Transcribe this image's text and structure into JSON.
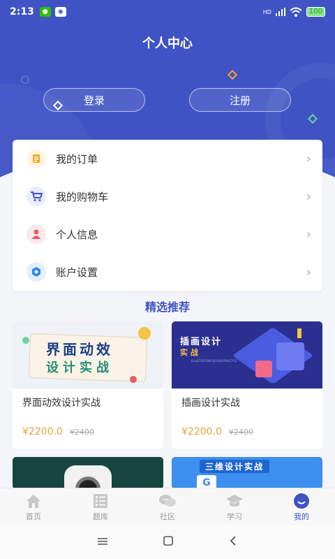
{
  "status": {
    "time": "2:13",
    "battery": "100",
    "signal_label": "HD"
  },
  "page": {
    "title": "个人中心"
  },
  "auth": {
    "login": "登录",
    "register": "注册"
  },
  "menu": [
    {
      "label": "我的订单",
      "icon": "order-icon",
      "color": "#f5a623"
    },
    {
      "label": "我的购物车",
      "icon": "cart-icon",
      "color": "#3f53c4"
    },
    {
      "label": "个人信息",
      "icon": "person-icon",
      "color": "#e85a6a"
    },
    {
      "label": "账户设置",
      "icon": "settings-hexagon-icon",
      "color": "#2f86f6"
    }
  ],
  "recommend": {
    "title": "精选推荐"
  },
  "courses": [
    {
      "name": "界面动效设计实战",
      "price": "¥2200.0",
      "old_price": "¥2400",
      "thumb_text_1": "界面动效",
      "thumb_text_2": "设计实战"
    },
    {
      "name": "插画设计实战",
      "price": "¥2200.0",
      "old_price": "¥2400",
      "thumb_text_1": "插画设计",
      "thumb_text_2": "实 战",
      "thumb_sub": "ILLUSTRATION DESIGN PRACTICE"
    },
    {
      "name": "",
      "price": "",
      "old_price": ""
    },
    {
      "name": "",
      "price": "",
      "old_price": "",
      "thumb_text_1": "三维设计实战"
    }
  ],
  "tabs": [
    {
      "label": "首页",
      "icon": "home-icon"
    },
    {
      "label": "题库",
      "icon": "question-bank-icon"
    },
    {
      "label": "社区",
      "icon": "community-icon"
    },
    {
      "label": "学习",
      "icon": "study-cap-icon"
    },
    {
      "label": "我的",
      "icon": "profile-icon",
      "active": true
    }
  ],
  "colors": {
    "primary": "#3f53c4",
    "price": "#e8a23a",
    "background": "#f4f5f8"
  }
}
